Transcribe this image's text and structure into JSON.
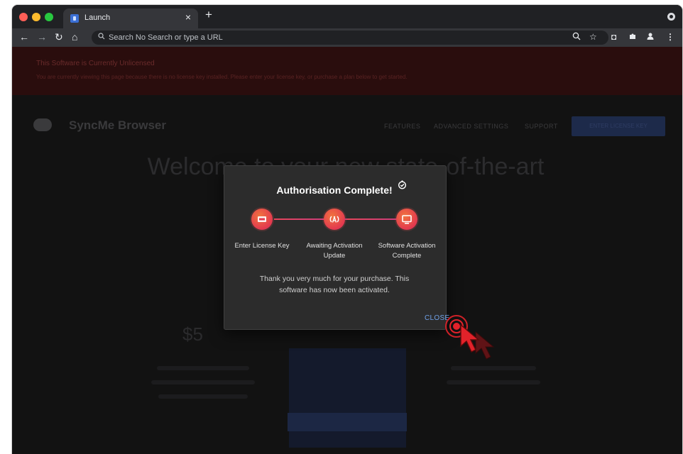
{
  "browser": {
    "tab_title": "Launch",
    "address_placeholder": "Search No Search or type a URL"
  },
  "page": {
    "banner_title": "This Software is Currently Unlicensed",
    "banner_text": "You are currently viewing this page because there is no license key installed. Please enter your license key, or purchase a plan below to get started.",
    "brand_name": "SyncMe Browser",
    "menu": [
      "FEATURES",
      "ADVANCED SETTINGS",
      "SUPPORT"
    ],
    "license_button": "ENTER LICENSE KEY",
    "hero_title": "Welcome to your new state-of-the-art",
    "price": "$5"
  },
  "modal": {
    "title": "Authorisation Complete!",
    "steps": [
      {
        "label": "Enter License Key",
        "icon": "keyboard-icon"
      },
      {
        "label": "Awaiting Activation Update",
        "icon": "antenna-icon"
      },
      {
        "label": "Software Activation Complete",
        "icon": "monitor-icon"
      }
    ],
    "message": "Thank you very much for your purchase. This software has now been activated.",
    "close_label": "CLOSE"
  },
  "colors": {
    "step_gradient_start": "#f0743f",
    "step_gradient_end": "#c92b62",
    "close_link": "#6fa0e6",
    "click_indicator": "#e2222a"
  }
}
